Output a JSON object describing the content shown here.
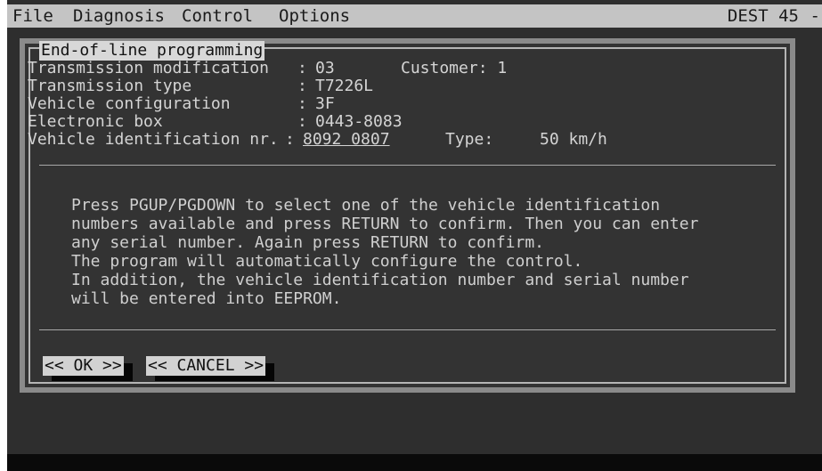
{
  "menubar": {
    "items": [
      "File",
      "Diagnosis",
      "Control",
      "Options"
    ],
    "right_label": "DEST 45",
    "right_dash": "-"
  },
  "dialog": {
    "title": "End-of-line programming",
    "info": {
      "modification_label": "Transmission modification",
      "modification_value": "03",
      "customer": "Customer: 1",
      "type_label": "Transmission type",
      "type_value": "T7226L",
      "config_label": "Vehicle configuration",
      "config_value": "3F",
      "ebox_label": "Electronic box",
      "ebox_value": "0443-8083",
      "vin_label": "Vehicle identification nr.",
      "vin_value": "8092 0807",
      "vehicle_type_label": "Type:",
      "vehicle_type_value": "50 km/h"
    },
    "message_lines": [
      "Press PGUP/PGDOWN to select one of the vehicle identification",
      "numbers available and press RETURN to confirm. Then you can enter",
      "any serial number. Again press RETURN to confirm.",
      "The program will automatically configure the control.",
      "In addition, the vehicle identification number and serial number",
      "will be entered into EEPROM."
    ],
    "ok_label": "<< OK >>",
    "cancel_label": "<< CANCEL >>"
  }
}
